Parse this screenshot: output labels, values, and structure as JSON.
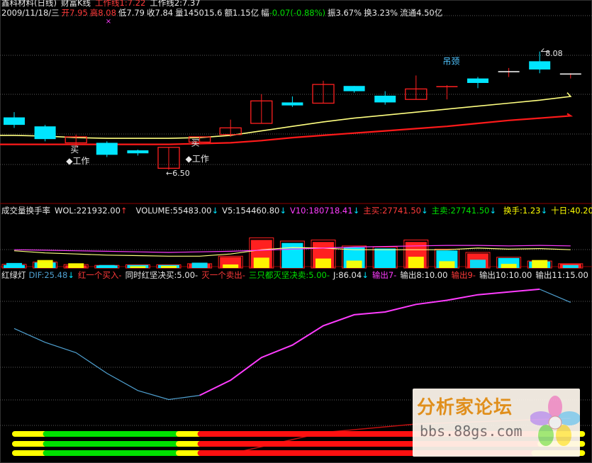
{
  "main": {
    "title": "鑫科材料(日线)",
    "formula": "财富K线",
    "formula_a": "工作线1:7.22",
    "formula_b": "工作线2:7.37",
    "date": "2009/11/18/三",
    "open_label": "开",
    "open": "7.95",
    "high_label": "高",
    "high": "8.08",
    "low_label": "低",
    "low": "7.79",
    "close_label": "收",
    "close": "7.84",
    "vol_label": "量",
    "vol": "145015.6",
    "amt_label": "额",
    "amt": "1.15亿",
    "chg_label": "幅",
    "chg": "-0.07(-0.88%)",
    "amp_label": "振",
    "amp": "3.67%",
    "turn_label": "换",
    "turn": "3.23%",
    "float_label": "流通",
    "float": "4.50亿"
  },
  "vol_panel": {
    "name": "成交量换手率",
    "wol": "WOL:221932.00",
    "volume": "VOLUME:55483.00",
    "v5": "V5:154460.80",
    "v10": "V10:180718.41",
    "buy": "主买:27741.50",
    "sell": "主卖:27741.50",
    "turn": "换手:1.23",
    "ten": "十日:40.20"
  },
  "ind_panel": {
    "name": "红绿灯",
    "dif": "DIF:25.48",
    "red_buy": "红一个买入",
    "both_red": "同时红坚决买:5.00",
    "one_off": "灭一个卖出",
    "three_off": "三只都灭坚决卖:5.00",
    "j": "J:86.04",
    "out7": "输出7",
    "out8": "输出8:10.00",
    "out9": "输出9",
    "out10": "输出10:10.00",
    "out11": "输出11:15.00"
  },
  "colors": {
    "up": "#ff2020",
    "down": "#00e5ff",
    "ma_yellow": "#ffff80",
    "ma_red": "#ff1a1a",
    "ma_magenta": "#ff3cff",
    "blue_line": "#4fa0d0",
    "yellow": "#ffff00",
    "green": "#00e000"
  },
  "chart_data": [
    {
      "type": "candlestick",
      "title": "鑫科材料(日线)",
      "candles": [
        {
          "o": 7.2,
          "h": 7.27,
          "l": 7.06,
          "c": 7.1
        },
        {
          "o": 7.08,
          "h": 7.1,
          "l": 6.88,
          "c": 6.91
        },
        {
          "o": 6.86,
          "h": 6.97,
          "l": 6.8,
          "c": 6.94
        },
        {
          "o": 6.86,
          "h": 6.88,
          "l": 6.67,
          "c": 6.7
        },
        {
          "o": 6.76,
          "h": 6.77,
          "l": 6.69,
          "c": 6.72
        },
        {
          "o": 6.52,
          "h": 6.8,
          "l": 6.5,
          "c": 6.8
        },
        {
          "o": 6.87,
          "h": 6.94,
          "l": 6.87,
          "c": 6.94
        },
        {
          "o": 6.97,
          "h": 7.17,
          "l": 6.94,
          "c": 7.06
        },
        {
          "o": 7.12,
          "h": 7.51,
          "l": 7.12,
          "c": 7.42
        },
        {
          "o": 7.4,
          "h": 7.48,
          "l": 7.34,
          "c": 7.36
        },
        {
          "o": 7.39,
          "h": 7.69,
          "l": 7.39,
          "c": 7.64
        },
        {
          "o": 7.62,
          "h": 7.62,
          "l": 7.53,
          "c": 7.55
        },
        {
          "o": 7.49,
          "h": 7.55,
          "l": 7.37,
          "c": 7.4
        },
        {
          "o": 7.44,
          "h": 7.76,
          "l": 7.44,
          "c": 7.58
        },
        {
          "o": 7.61,
          "h": 7.63,
          "l": 7.44,
          "c": 7.61
        },
        {
          "o": 7.72,
          "h": 7.74,
          "l": 7.59,
          "c": 7.66
        },
        {
          "o": 7.81,
          "h": 7.86,
          "l": 7.74,
          "c": 7.81
        },
        {
          "o": 7.95,
          "h": 8.08,
          "l": 7.79,
          "c": 7.84
        },
        {
          "o": 7.78,
          "h": 7.79,
          "l": 7.72,
          "c": 7.78
        }
      ],
      "ma_yellow": [
        6.96,
        6.95,
        6.93,
        6.92,
        6.92,
        6.92,
        6.93,
        6.96,
        7.02,
        7.08,
        7.14,
        7.19,
        7.23,
        7.27,
        7.31,
        7.35,
        7.39,
        7.43,
        7.48
      ],
      "ma_red": [
        6.84,
        6.84,
        6.84,
        6.84,
        6.84,
        6.84,
        6.85,
        6.86,
        6.89,
        6.93,
        6.96,
        6.99,
        7.02,
        7.05,
        7.08,
        7.12,
        7.16,
        7.19,
        7.22
      ],
      "annotations": [
        {
          "text": "买",
          "at": 2
        },
        {
          "text": "◆工作",
          "at": 2
        },
        {
          "text": "←6.50",
          "at": 5
        },
        {
          "text": "买",
          "at": 6
        },
        {
          "text": "◆工作",
          "at": 6
        },
        {
          "text": "吊颈",
          "at": 14
        },
        {
          "text": "8.08",
          "at": 17
        }
      ]
    },
    {
      "type": "bar",
      "title": "成交量换手率",
      "series": [
        {
          "name": "VOLUME",
          "values": [
            0.17,
            0.27,
            0.16,
            0.1,
            0.06,
            0.07,
            0.18,
            0.12,
            0.35,
            0.23,
            0.32,
            0.25,
            0.22,
            0.38,
            0.23,
            0.28,
            0.14,
            0.27,
            0.1
          ]
        },
        {
          "name": "主卖",
          "values": [
            0.06,
            0.11,
            0.05,
            0.05,
            0.06,
            0.06,
            0.08,
            0.22,
            0.56,
            0.5,
            0.52,
            0.41,
            0.39,
            0.52,
            0.35,
            0.29,
            0.2,
            0.13,
            0.08
          ]
        },
        {
          "name": "V5",
          "values": [
            0.32,
            0.28,
            0.26,
            0.24,
            0.23,
            0.22,
            0.22,
            0.26,
            0.34,
            0.38,
            0.37,
            0.34,
            0.34,
            0.34,
            0.34,
            0.37,
            0.35,
            0.36,
            0.34
          ]
        },
        {
          "name": "V10",
          "values": [
            0.34,
            0.33,
            0.32,
            0.31,
            0.3,
            0.29,
            0.3,
            0.31,
            0.33,
            0.35,
            0.37,
            0.39,
            0.4,
            0.41,
            0.42,
            0.42,
            0.41,
            0.42,
            0.41
          ]
        }
      ],
      "up_flags": [
        false,
        false,
        true,
        false,
        false,
        false,
        true,
        true,
        true,
        false,
        true,
        false,
        false,
        true,
        false,
        true,
        false,
        false,
        true
      ]
    },
    {
      "type": "line",
      "title": "红绿灯",
      "series": [
        {
          "name": "DIF",
          "values": [
            -40,
            -60,
            -75,
            -105,
            -130,
            -143,
            -137,
            -115,
            -82,
            -64,
            -36,
            -20,
            -16,
            -5,
            1,
            9,
            13,
            17,
            -2
          ]
        }
      ],
      "up_from_index": 6,
      "bands": [
        {
          "segments": [
            [
              "yellow",
              0,
              1
            ],
            [
              "green",
              1,
              5.3
            ],
            [
              "yellow",
              5.3,
              6
            ],
            [
              "red",
              6,
              17
            ],
            [
              "yellow",
              17,
              18.4
            ]
          ]
        },
        {
          "segments": [
            [
              "yellow",
              0,
              1
            ],
            [
              "green",
              1,
              5.3
            ],
            [
              "yellow",
              5.3,
              6
            ],
            [
              "red",
              6,
              17
            ],
            [
              "yellow",
              17,
              18.4
            ]
          ]
        },
        {
          "segments": [
            [
              "yellow",
              0,
              1
            ],
            [
              "green",
              1,
              5.3
            ],
            [
              "yellow",
              5.3,
              6
            ],
            [
              "red",
              6,
              16.8
            ],
            [
              "yellow",
              16.8,
              18.4
            ]
          ]
        }
      ]
    }
  ]
}
